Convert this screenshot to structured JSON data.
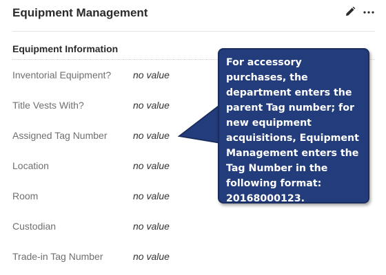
{
  "header": {
    "title": "Equipment Management",
    "edit_icon": "pencil-icon",
    "more_icon": "ellipsis-icon"
  },
  "section": {
    "title": "Equipment Information"
  },
  "fields": [
    {
      "label": "Inventorial Equipment?",
      "value": "no value"
    },
    {
      "label": "Title Vests With?",
      "value": "no value"
    },
    {
      "label": "Assigned Tag Number",
      "value": "no value"
    },
    {
      "label": "Location",
      "value": "no value"
    },
    {
      "label": "Room",
      "value": "no value"
    },
    {
      "label": "Custodian",
      "value": "no value"
    },
    {
      "label": "Trade-in Tag Number",
      "value": "no value"
    }
  ],
  "callout": {
    "text": "For accessory purchases, the department enters the parent Tag number; for new equipment acquisitions, Equipment Management enters the Tag Number in the following format: 20168000123."
  },
  "colors": {
    "callout_bg": "#233c7c",
    "label_text": "#6f6f6f",
    "value_text": "#333333"
  }
}
